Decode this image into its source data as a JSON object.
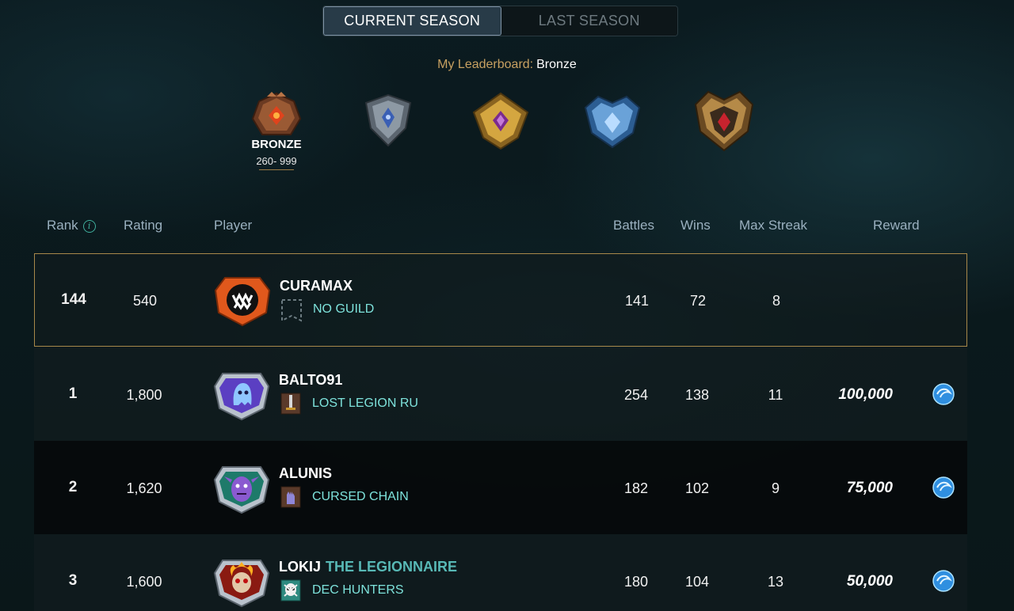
{
  "tabs": {
    "current": "CURRENT SEASON",
    "last": "LAST SEASON"
  },
  "my_leaderboard": {
    "label": "My Leaderboard:",
    "value": "Bronze"
  },
  "leagues": [
    {
      "icon": "bronze-league-badge-icon",
      "name": "BRONZE",
      "range": "260- 999",
      "selected": true
    },
    {
      "icon": "silver-league-badge-icon"
    },
    {
      "icon": "gold-league-badge-icon"
    },
    {
      "icon": "diamond-league-badge-icon"
    },
    {
      "icon": "champion-league-badge-icon"
    }
  ],
  "columns": {
    "rank": "Rank",
    "rating": "Rating",
    "player": "Player",
    "battles": "Battles",
    "wins": "Wins",
    "max_streak": "Max Streak",
    "reward": "Reward"
  },
  "my_row": {
    "rank": "144",
    "rating": "540",
    "player": "CURAMAX",
    "guild": "NO GUILD",
    "battles": "141",
    "wins": "72",
    "max_streak": "8"
  },
  "rows": [
    {
      "rank": "1",
      "rating": "1,800",
      "player": "BALTO91",
      "title": "",
      "guild": "LOST LEGION RU",
      "battles": "254",
      "wins": "138",
      "max_streak": "11",
      "reward": "100,000"
    },
    {
      "rank": "2",
      "rating": "1,620",
      "player": "ALUNIS",
      "title": "",
      "guild": "CURSED CHAIN",
      "battles": "182",
      "wins": "102",
      "max_streak": "9",
      "reward": "75,000"
    },
    {
      "rank": "3",
      "rating": "1,600",
      "player": "LOKIJ",
      "title": "THE LEGIONNAIRE",
      "guild": "DEC HUNTERS",
      "battles": "180",
      "wins": "104",
      "max_streak": "13",
      "reward": "50,000"
    }
  ],
  "colors": {
    "accent_gold": "#c7a061",
    "guild_text": "#7ee3dc",
    "title_text": "#58b9b6"
  }
}
